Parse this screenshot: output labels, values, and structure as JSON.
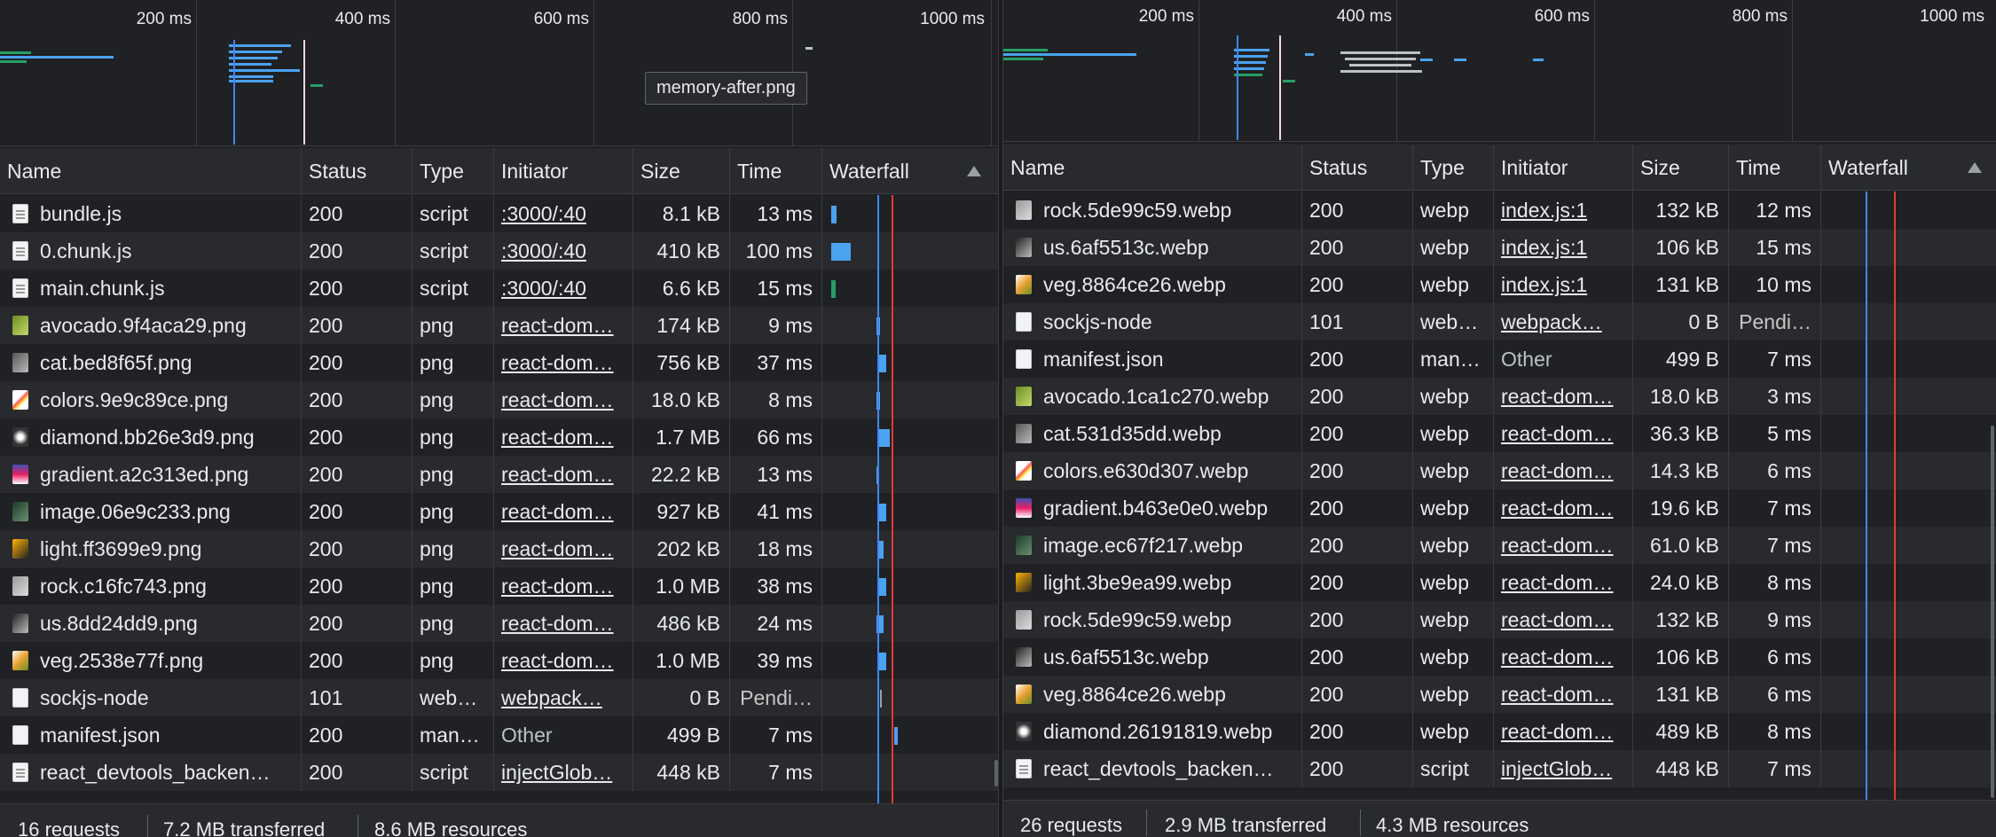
{
  "left": {
    "overview": {
      "tick_labels": [
        "200 ms",
        "400 ms",
        "600 ms",
        "800 ms",
        "1000 ms"
      ]
    },
    "tooltip": "memory-after.png",
    "columns": [
      "Name",
      "Status",
      "Type",
      "Initiator",
      "Size",
      "Time",
      "Waterfall"
    ],
    "rows": [
      {
        "name": "bundle.js",
        "icon": "script-file-icon",
        "status": "200",
        "type": "script",
        "initiator": ":3000/:40",
        "size": "8.1 kB",
        "time": "13 ms"
      },
      {
        "name": "0.chunk.js",
        "icon": "script-file-icon",
        "status": "200",
        "type": "script",
        "initiator": ":3000/:40",
        "size": "410 kB",
        "time": "100 ms"
      },
      {
        "name": "main.chunk.js",
        "icon": "script-file-icon",
        "status": "200",
        "type": "script",
        "initiator": ":3000/:40",
        "size": "6.6 kB",
        "time": "15 ms"
      },
      {
        "name": "avocado.9f4aca29.png",
        "icon": "avocado-thumbnail-icon",
        "status": "200",
        "type": "png",
        "initiator": "react-dom…",
        "size": "174 kB",
        "time": "9 ms"
      },
      {
        "name": "cat.bed8f65f.png",
        "icon": "cat-thumbnail-icon",
        "status": "200",
        "type": "png",
        "initiator": "react-dom…",
        "size": "756 kB",
        "time": "37 ms"
      },
      {
        "name": "colors.9e9c89ce.png",
        "icon": "colors-thumbnail-icon",
        "status": "200",
        "type": "png",
        "initiator": "react-dom…",
        "size": "18.0 kB",
        "time": "8 ms"
      },
      {
        "name": "diamond.bb26e3d9.png",
        "icon": "diamond-thumbnail-icon",
        "status": "200",
        "type": "png",
        "initiator": "react-dom…",
        "size": "1.7 MB",
        "time": "66 ms"
      },
      {
        "name": "gradient.a2c313ed.png",
        "icon": "gradient-thumbnail-icon",
        "status": "200",
        "type": "png",
        "initiator": "react-dom…",
        "size": "22.2 kB",
        "time": "13 ms"
      },
      {
        "name": "image.06e9c233.png",
        "icon": "image-thumbnail-icon",
        "status": "200",
        "type": "png",
        "initiator": "react-dom…",
        "size": "927 kB",
        "time": "41 ms"
      },
      {
        "name": "light.ff3699e9.png",
        "icon": "light-thumbnail-icon",
        "status": "200",
        "type": "png",
        "initiator": "react-dom…",
        "size": "202 kB",
        "time": "18 ms"
      },
      {
        "name": "rock.c16fc743.png",
        "icon": "rock-thumbnail-icon",
        "status": "200",
        "type": "png",
        "initiator": "react-dom…",
        "size": "1.0 MB",
        "time": "38 ms"
      },
      {
        "name": "us.8dd24dd9.png",
        "icon": "us-thumbnail-icon",
        "status": "200",
        "type": "png",
        "initiator": "react-dom…",
        "size": "486 kB",
        "time": "24 ms"
      },
      {
        "name": "veg.2538e77f.png",
        "icon": "veg-thumbnail-icon",
        "status": "200",
        "type": "png",
        "initiator": "react-dom…",
        "size": "1.0 MB",
        "time": "39 ms"
      },
      {
        "name": "sockjs-node",
        "icon": "blank-file-icon",
        "status": "101",
        "type": "web…",
        "initiator": "webpack…",
        "size": "0 B",
        "time": "Pendi…"
      },
      {
        "name": "manifest.json",
        "icon": "blank-file-icon",
        "status": "200",
        "type": "man…",
        "initiator": "Other",
        "size": "499 B",
        "time": "7 ms"
      },
      {
        "name": "react_devtools_backen…",
        "icon": "script-file-icon",
        "status": "200",
        "type": "script",
        "initiator": "injectGlob…",
        "size": "448 kB",
        "time": "7 ms"
      }
    ],
    "footer": {
      "requests": "16 requests",
      "transferred": "7.2 MB transferred",
      "resources": "8.6 MB resources"
    }
  },
  "right": {
    "overview": {
      "tick_labels": [
        "200 ms",
        "400 ms",
        "600 ms",
        "800 ms",
        "1000 ms"
      ]
    },
    "columns": [
      "Name",
      "Status",
      "Type",
      "Initiator",
      "Size",
      "Time",
      "Waterfall"
    ],
    "rows": [
      {
        "name": "rock.5de99c59.webp",
        "icon": "rock-thumbnail-icon",
        "status": "200",
        "type": "webp",
        "initiator": "index.js:1",
        "size": "132 kB",
        "time": "12 ms"
      },
      {
        "name": "us.6af5513c.webp",
        "icon": "us-thumbnail-icon",
        "status": "200",
        "type": "webp",
        "initiator": "index.js:1",
        "size": "106 kB",
        "time": "15 ms"
      },
      {
        "name": "veg.8864ce26.webp",
        "icon": "veg-thumbnail-icon",
        "status": "200",
        "type": "webp",
        "initiator": "index.js:1",
        "size": "131 kB",
        "time": "10 ms"
      },
      {
        "name": "sockjs-node",
        "icon": "blank-file-icon",
        "status": "101",
        "type": "web…",
        "initiator": "webpack…",
        "size": "0 B",
        "time": "Pendi…"
      },
      {
        "name": "manifest.json",
        "icon": "blank-file-icon",
        "status": "200",
        "type": "man…",
        "initiator": "Other",
        "size": "499 B",
        "time": "7 ms"
      },
      {
        "name": "avocado.1ca1c270.webp",
        "icon": "avocado-thumbnail-icon",
        "status": "200",
        "type": "webp",
        "initiator": "react-dom…",
        "size": "18.0 kB",
        "time": "3 ms"
      },
      {
        "name": "cat.531d35dd.webp",
        "icon": "cat-thumbnail-icon",
        "status": "200",
        "type": "webp",
        "initiator": "react-dom…",
        "size": "36.3 kB",
        "time": "5 ms"
      },
      {
        "name": "colors.e630d307.webp",
        "icon": "colors-thumbnail-icon",
        "status": "200",
        "type": "webp",
        "initiator": "react-dom…",
        "size": "14.3 kB",
        "time": "6 ms"
      },
      {
        "name": "gradient.b463e0e0.webp",
        "icon": "gradient-thumbnail-icon",
        "status": "200",
        "type": "webp",
        "initiator": "react-dom…",
        "size": "19.6 kB",
        "time": "7 ms"
      },
      {
        "name": "image.ec67f217.webp",
        "icon": "image-thumbnail-icon",
        "status": "200",
        "type": "webp",
        "initiator": "react-dom…",
        "size": "61.0 kB",
        "time": "7 ms"
      },
      {
        "name": "light.3be9ea99.webp",
        "icon": "light-thumbnail-icon",
        "status": "200",
        "type": "webp",
        "initiator": "react-dom…",
        "size": "24.0 kB",
        "time": "8 ms"
      },
      {
        "name": "rock.5de99c59.webp",
        "icon": "rock-thumbnail-icon",
        "status": "200",
        "type": "webp",
        "initiator": "react-dom…",
        "size": "132 kB",
        "time": "9 ms"
      },
      {
        "name": "us.6af5513c.webp",
        "icon": "us-thumbnail-icon",
        "status": "200",
        "type": "webp",
        "initiator": "react-dom…",
        "size": "106 kB",
        "time": "6 ms"
      },
      {
        "name": "veg.8864ce26.webp",
        "icon": "veg-thumbnail-icon",
        "status": "200",
        "type": "webp",
        "initiator": "react-dom…",
        "size": "131 kB",
        "time": "6 ms"
      },
      {
        "name": "diamond.26191819.webp",
        "icon": "diamond-thumbnail-icon",
        "status": "200",
        "type": "webp",
        "initiator": "react-dom…",
        "size": "489 kB",
        "time": "8 ms"
      },
      {
        "name": "react_devtools_backen…",
        "icon": "script-file-icon",
        "status": "200",
        "type": "script",
        "initiator": "injectGlob…",
        "size": "448 kB",
        "time": "7 ms"
      }
    ],
    "footer": {
      "requests": "26 requests",
      "transferred": "2.9 MB transferred",
      "resources": "4.3 MB resources"
    }
  },
  "colors": {
    "waiting": "#25a065",
    "download": "#4aa3f0",
    "dom_loaded": "#4285f4",
    "load": "#e57373",
    "background": "#202124"
  }
}
